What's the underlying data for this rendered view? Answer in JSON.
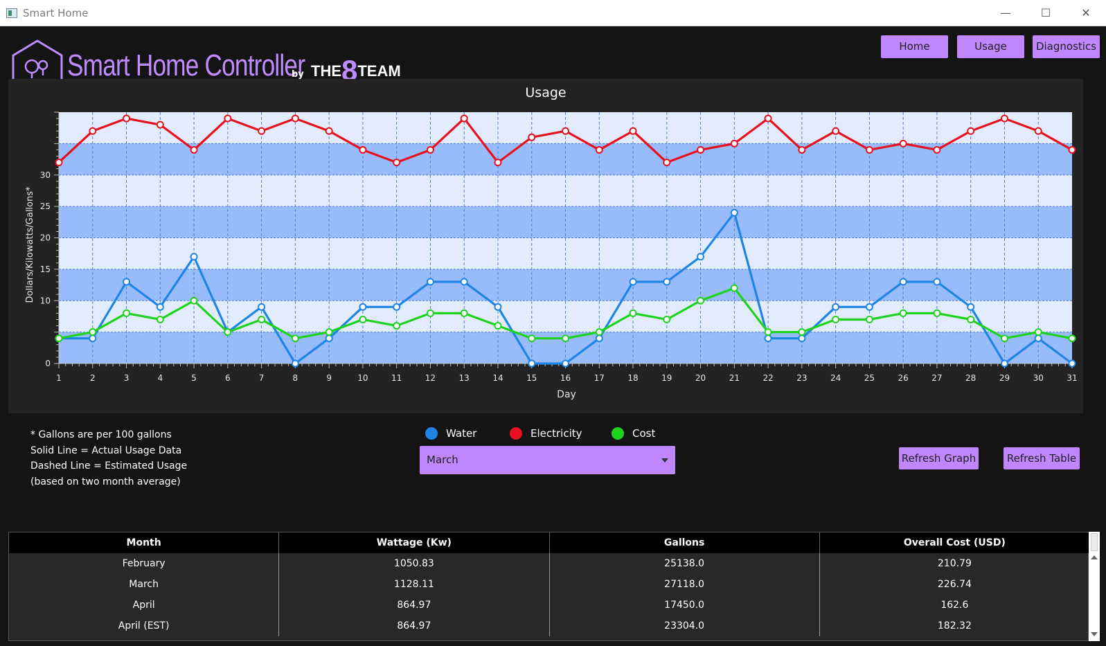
{
  "window": {
    "title": "Smart Home"
  },
  "header": {
    "brand": "Smart Home Controller",
    "by": "by",
    "team_prefix": "THE",
    "team_digit": "8",
    "team_suffix": "TEAM"
  },
  "nav": {
    "home": "Home",
    "usage": "Usage",
    "diagnostics": "Diagnostics"
  },
  "chart_data": {
    "type": "line",
    "title": "Usage",
    "xlabel": "Day",
    "ylabel": "Dollars/Kilowatts/Gallons*",
    "x": [
      1,
      2,
      3,
      4,
      5,
      6,
      7,
      8,
      9,
      10,
      11,
      12,
      13,
      14,
      15,
      16,
      17,
      18,
      19,
      20,
      21,
      22,
      23,
      24,
      25,
      26,
      27,
      28,
      29,
      30,
      31
    ],
    "xlim": [
      1,
      31
    ],
    "ylim": [
      0,
      40
    ],
    "yticks": [
      0,
      10,
      15,
      20,
      25,
      30
    ],
    "grid": true,
    "series": [
      {
        "name": "Water",
        "color": "#1e84e6",
        "values": [
          4,
          4,
          13,
          9,
          17,
          5,
          9,
          0,
          4,
          9,
          9,
          13,
          13,
          9,
          0,
          0,
          4,
          13,
          13,
          17,
          24,
          4,
          4,
          9,
          9,
          13,
          13,
          9,
          0,
          4,
          0
        ]
      },
      {
        "name": "Electricity",
        "color": "#e8101e",
        "values": [
          32,
          37,
          39,
          38,
          34,
          39,
          37,
          39,
          37,
          34,
          32,
          34,
          39,
          32,
          36,
          37,
          34,
          37,
          32,
          34,
          35,
          39,
          34,
          37,
          34,
          35,
          34,
          37,
          39,
          37,
          34
        ]
      },
      {
        "name": "Cost",
        "color": "#1ed31e",
        "values": [
          4,
          5,
          8,
          7,
          10,
          5,
          7,
          4,
          5,
          7,
          6,
          8,
          8,
          6,
          4,
          4,
          5,
          8,
          7,
          10,
          12,
          5,
          5,
          7,
          7,
          8,
          8,
          7,
          4,
          5,
          4
        ]
      }
    ]
  },
  "notes": [
    "*  Gallons are per 100 gallons",
    "Solid Line = Actual Usage Data",
    "Dashed Line = Estimated Usage",
    "(based on two month average)"
  ],
  "legend": {
    "water": "Water",
    "electricity": "Electricity",
    "cost": "Cost"
  },
  "colors": {
    "water": "#1e84e6",
    "electricity": "#e8101e",
    "cost": "#1ed31e",
    "accent": "#bf87fb"
  },
  "month_select": {
    "value": "March"
  },
  "buttons": {
    "refresh_graph": "Refresh Graph",
    "refresh_table": "Refresh Table"
  },
  "table": {
    "headers": [
      "Month",
      "Wattage (Kw)",
      "Gallons",
      "Overall Cost (USD)"
    ],
    "rows": [
      [
        "February",
        "1050.83",
        "25138.0",
        "210.79"
      ],
      [
        "March",
        "1128.11",
        "27118.0",
        "226.74"
      ],
      [
        "April",
        "864.97",
        "17450.0",
        "162.6"
      ],
      [
        "April (EST)",
        "864.97",
        "23304.0",
        "182.32"
      ]
    ]
  }
}
